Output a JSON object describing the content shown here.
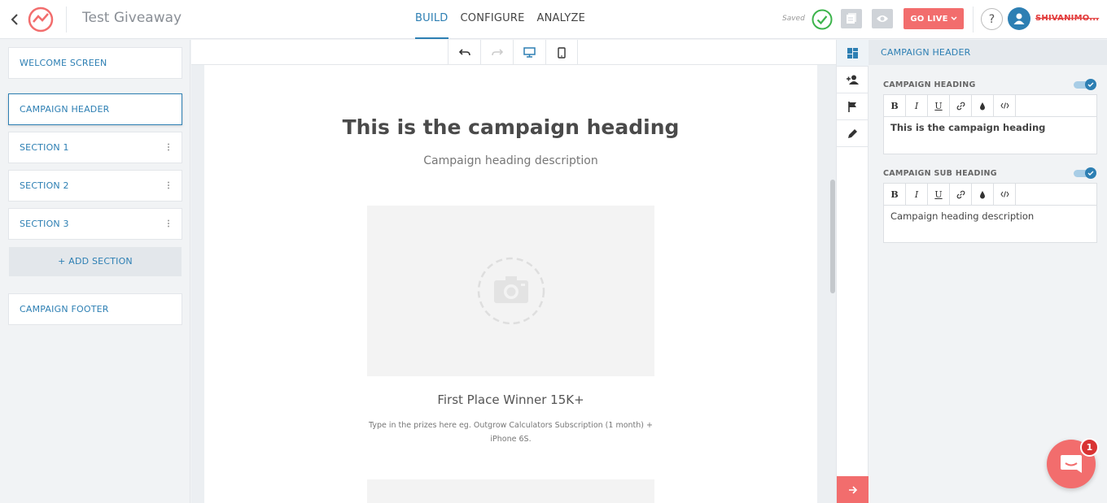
{
  "header": {
    "project_title": "Test Giveaway",
    "nav": [
      {
        "label": "BUILD"
      },
      {
        "label": "CONFIGURE"
      },
      {
        "label": "ANALYZE"
      }
    ],
    "saved_label": "Saved",
    "go_live_label": "GO LIVE",
    "help_label": "?",
    "username": "SHIVANIMO..."
  },
  "sidebar": {
    "sections": [
      {
        "label": "WELCOME SCREEN"
      },
      {
        "label": "CAMPAIGN HEADER"
      },
      {
        "label": "SECTION 1"
      },
      {
        "label": "SECTION 2"
      },
      {
        "label": "SECTION 3"
      }
    ],
    "add_section_label": "+ ADD SECTION",
    "footer_label": "CAMPAIGN FOOTER"
  },
  "canvas": {
    "heading": "This is the campaign heading",
    "description": "Campaign heading description",
    "prize_title": "First Place Winner 15K+",
    "prize_description": "Type in the prizes here eg. Outgrow Calculators Subscription (1 month) + iPhone 6S."
  },
  "panel": {
    "title": "CAMPAIGN HEADER",
    "fields": [
      {
        "label": "CAMPAIGN HEADING",
        "value": "This is the campaign heading"
      },
      {
        "label": "CAMPAIGN SUB HEADING",
        "value": "Campaign heading description"
      }
    ],
    "toolbar": [
      "B",
      "I",
      "U"
    ]
  },
  "chat": {
    "badge": "1"
  },
  "colors": {
    "accent": "#2d7fb3",
    "brand_red": "#f26d6d",
    "saved_green": "#3cb44b"
  }
}
